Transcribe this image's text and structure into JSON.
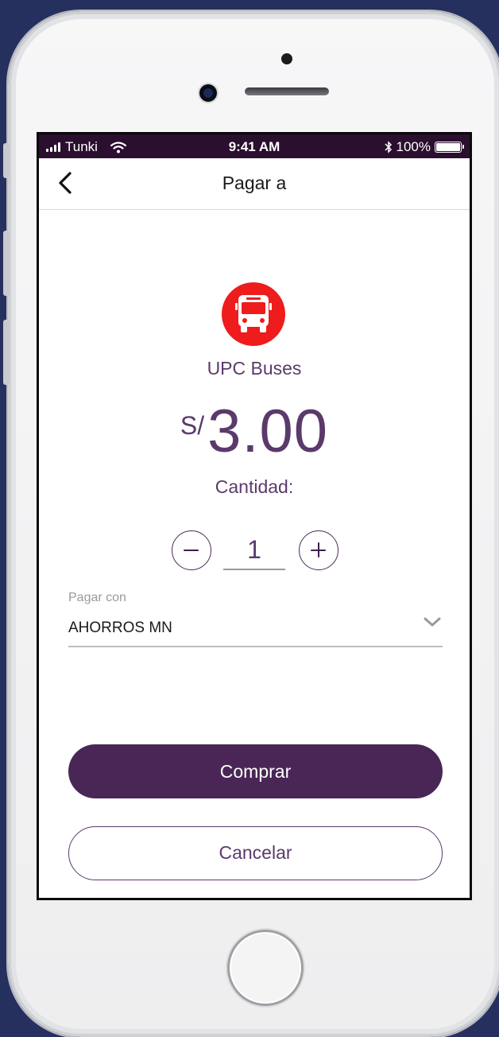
{
  "status_bar": {
    "carrier": "Tunki",
    "time": "9:41 AM",
    "battery_text": "100%",
    "icons": [
      "signal-icon",
      "wifi-icon",
      "bluetooth-icon",
      "battery-icon"
    ]
  },
  "header": {
    "back_icon": "chevron-left-icon",
    "title": "Pagar a"
  },
  "merchant": {
    "icon": "bus-icon",
    "icon_color": "#ee1c1c",
    "name": "UPC Buses"
  },
  "amount": {
    "currency": "S/",
    "value": "3.00"
  },
  "quantity": {
    "label": "Cantidad:",
    "value": "1",
    "decrement_icon": "minus-icon",
    "increment_icon": "plus-icon"
  },
  "payment": {
    "label": "Pagar con",
    "selected": "AHORROS MN",
    "dropdown_icon": "chevron-down-icon"
  },
  "actions": {
    "buy_label": "Comprar",
    "cancel_label": "Cancelar"
  },
  "colors": {
    "accent": "#4a2657",
    "text_accent": "#5b3a6b",
    "status_bar": "#2b0f2e",
    "background": "#25305e"
  }
}
